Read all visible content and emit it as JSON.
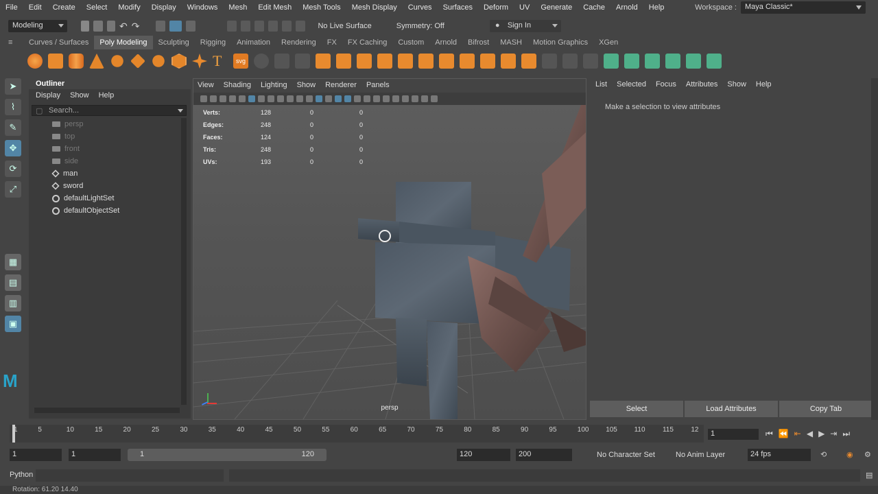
{
  "menubar": {
    "items": [
      "File",
      "Edit",
      "Create",
      "Select",
      "Modify",
      "Display",
      "Windows",
      "Mesh",
      "Edit Mesh",
      "Mesh Tools",
      "Mesh Display",
      "Curves",
      "Surfaces",
      "Deform",
      "UV",
      "Generate",
      "Cache",
      "Arnold",
      "Help"
    ],
    "workspace_label": "Workspace :",
    "workspace_value": "Maya Classic*"
  },
  "statusline": {
    "mode": "Modeling",
    "live_surface": "No Live Surface",
    "symmetry": "Symmetry: Off",
    "sign_in": "Sign In"
  },
  "shelf": {
    "tabs": [
      "Curves / Surfaces",
      "Poly Modeling",
      "Sculpting",
      "Rigging",
      "Animation",
      "Rendering",
      "FX",
      "FX Caching",
      "Custom",
      "Arnold",
      "Bifrost",
      "MASH",
      "Motion Graphics",
      "XGen"
    ],
    "active_tab": "Poly Modeling",
    "text_icon": "T",
    "svg_icon_label": "svg"
  },
  "outliner": {
    "title": "Outliner",
    "menu": [
      "Display",
      "Show",
      "Help"
    ],
    "search_placeholder": "Search...",
    "items": [
      {
        "label": "persp",
        "icon": "camera-icon",
        "dim": true
      },
      {
        "label": "top",
        "icon": "camera-icon",
        "dim": true
      },
      {
        "label": "front",
        "icon": "camera-icon",
        "dim": true
      },
      {
        "label": "side",
        "icon": "camera-icon",
        "dim": true
      },
      {
        "label": "man",
        "icon": "mesh-icon",
        "dim": false
      },
      {
        "label": "sword",
        "icon": "mesh-icon",
        "dim": false
      },
      {
        "label": "defaultLightSet",
        "icon": "set-icon",
        "dim": false
      },
      {
        "label": "defaultObjectSet",
        "icon": "set-icon",
        "dim": false
      }
    ]
  },
  "viewport": {
    "menu": [
      "View",
      "Shading",
      "Lighting",
      "Show",
      "Renderer",
      "Panels"
    ],
    "camera_label": "persp",
    "hud": [
      {
        "label": "Verts:",
        "values": [
          "128",
          "0",
          "0"
        ]
      },
      {
        "label": "Edges:",
        "values": [
          "248",
          "0",
          "0"
        ]
      },
      {
        "label": "Faces:",
        "values": [
          "124",
          "0",
          "0"
        ]
      },
      {
        "label": "Tris:",
        "values": [
          "248",
          "0",
          "0"
        ]
      },
      {
        "label": "UVs:",
        "values": [
          "193",
          "0",
          "0"
        ]
      }
    ]
  },
  "attribute_editor": {
    "menu": [
      "List",
      "Selected",
      "Focus",
      "Attributes",
      "Show",
      "Help"
    ],
    "message": "Make a selection to view attributes",
    "buttons": [
      "Select",
      "Load Attributes",
      "Copy Tab"
    ]
  },
  "timeslider": {
    "ticks": [
      "1",
      "5",
      "10",
      "15",
      "20",
      "25",
      "30",
      "35",
      "40",
      "45",
      "50",
      "55",
      "60",
      "65",
      "70",
      "75",
      "80",
      "85",
      "90",
      "95",
      "100",
      "105",
      "110",
      "115",
      "12"
    ],
    "current_frame": "1"
  },
  "range": {
    "start": "1",
    "playback_start": "1",
    "slider_start": "1",
    "slider_end": "120",
    "playback_end": "120",
    "end": "200",
    "character_set": "No Character Set",
    "anim_layer": "No Anim Layer",
    "fps": "24 fps"
  },
  "cmdline": {
    "language": "Python"
  },
  "helpline": {
    "text": "Rotation:   61.20     14.40"
  }
}
